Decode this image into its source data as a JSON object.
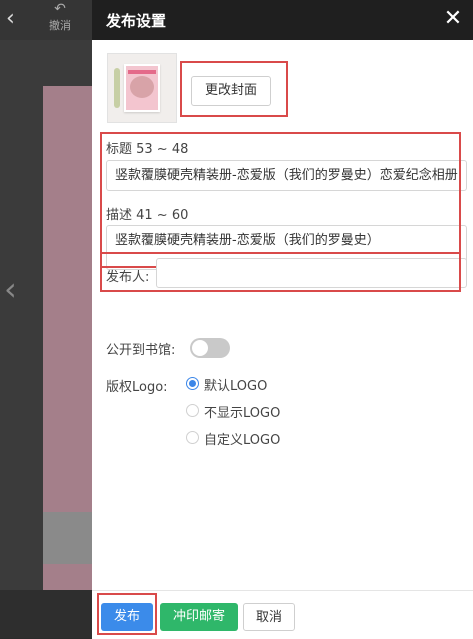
{
  "editor": {
    "back_icon": "chevron-left-icon",
    "undo_label": "撤消",
    "undo_icon": "undo-arrow-icon"
  },
  "panel": {
    "title": "发布设置",
    "close_icon": "close-icon"
  },
  "cover": {
    "change_button": "更改封面"
  },
  "title_field": {
    "label": "标题 53 ~ 48",
    "value": "竖款覆膜硬壳精装册-恋爱版（我们的罗曼史）恋爱纪念相册"
  },
  "description_field": {
    "label": "描述 41 ~ 60",
    "value": "竖款覆膜硬壳精装册-恋爱版（我们的罗曼史）"
  },
  "publisher_field": {
    "label": "发布人:",
    "value": ""
  },
  "public_library": {
    "label": "公开到书馆:",
    "enabled": false
  },
  "copyright_logo": {
    "label": "版权Logo:",
    "options": [
      "默认LOGO",
      "不显示LOGO",
      "自定义LOGO"
    ],
    "selected": "默认LOGO"
  },
  "footer": {
    "publish_label": "发布",
    "print_mail_label": "冲印邮寄",
    "cancel_label": "取消"
  },
  "colors": {
    "primary_blue": "#3b8bea",
    "green": "#2fb76a",
    "highlight_red": "#d94a4a",
    "header_bg": "#1f1f1f"
  }
}
